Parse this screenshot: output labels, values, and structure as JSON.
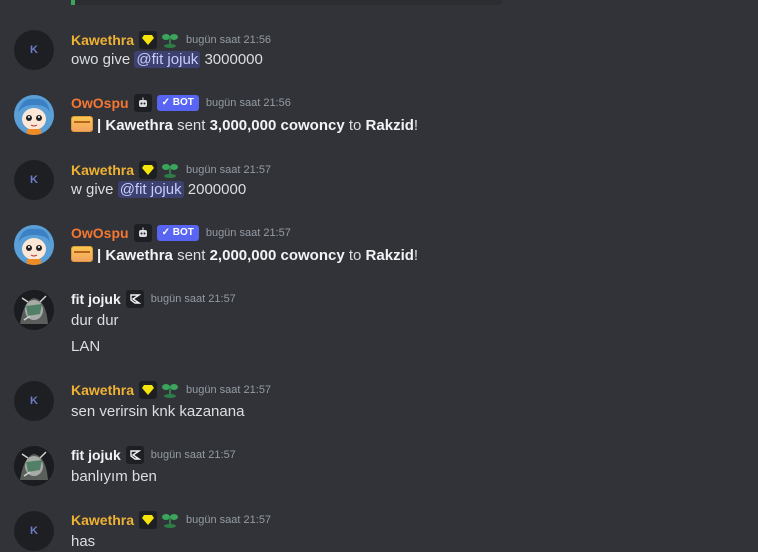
{
  "meta_time_prefix": "bugün saat",
  "messages": [
    {
      "author": "Kawethra",
      "avatar_letter": "K",
      "time": "bugün saat 21:56",
      "text_pre": "owo give ",
      "mention": "@fit jojuk",
      "text_post": " 3000000"
    },
    {
      "author": "OwOspu",
      "bot_tag": "✓ BOT",
      "time": "bugün saat 21:56",
      "sep": "| ",
      "sender": "Kawethra",
      "sent": " sent ",
      "amount": "3,000,000 cowoncy",
      "to": " to ",
      "recipient": "Rakzid",
      "end": "!"
    },
    {
      "author": "Kawethra",
      "avatar_letter": "K",
      "time": "bugün saat 21:57",
      "text_pre": "w give ",
      "mention": "@fit jojuk",
      "text_post": " 2000000"
    },
    {
      "author": "OwOspu",
      "bot_tag": "✓ BOT",
      "time": "bugün saat 21:57",
      "sep": "| ",
      "sender": "Kawethra",
      "sent": " sent ",
      "amount": "2,000,000 cowoncy",
      "to": " to ",
      "recipient": "Rakzid",
      "end": "!"
    },
    {
      "author": "fit jojuk",
      "time": "bugün saat 21:57",
      "lines": [
        "dur dur",
        "LAN"
      ]
    },
    {
      "author": "Kawethra",
      "avatar_letter": "K",
      "time": "bugün saat 21:57",
      "text": "sen verirsin knk kazanana"
    },
    {
      "author": "fit jojuk",
      "time": "bugün saat 21:57",
      "text": "banlıyım ben"
    },
    {
      "author": "Kawethra",
      "avatar_letter": "K",
      "time": "bugün saat 21:57",
      "text": "has"
    }
  ],
  "colors": {
    "kawethra": "#f0b232",
    "owospu": "#f57731",
    "fitjojuk": "#f2f3f5",
    "background": "#313338",
    "mention": "#5865f2"
  },
  "icons": [
    "diamond-badge-icon",
    "sprout-icon",
    "robot-icon",
    "bot-tag",
    "card-emoji",
    "brand-badge-icon"
  ]
}
